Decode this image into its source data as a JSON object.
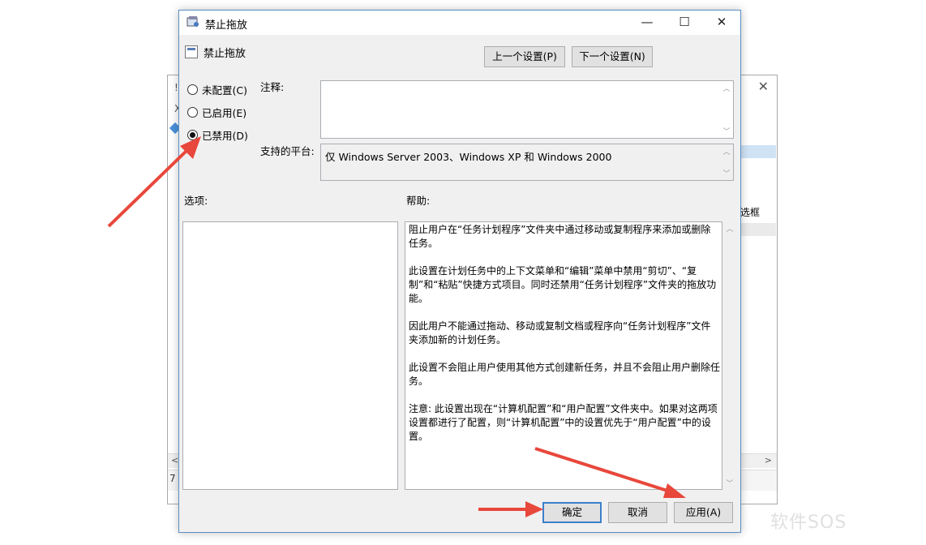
{
  "background_window": {
    "title_char": "!",
    "menu_char": "X",
    "side_text": "选框",
    "status_text": "7"
  },
  "dialog": {
    "title": "禁止拖放",
    "header": "禁止拖放",
    "prev_button": "上一个设置(P)",
    "next_button": "下一个设置(N)",
    "radios": [
      {
        "label": "未配置(C)",
        "selected": false
      },
      {
        "label": "已启用(E)",
        "selected": false
      },
      {
        "label": "已禁用(D)",
        "selected": true
      }
    ],
    "comment_label": "注释:",
    "comment_value": "",
    "platform_label": "支持的平台:",
    "platform_value": "仅 Windows Server 2003、Windows XP 和 Windows 2000",
    "options_label": "选项:",
    "help_label": "帮助:",
    "help_text": "阻止用户在“任务计划程序”文件夹中通过移动或复制程序来添加或删除任务。\n\n此设置在计划任务中的上下文菜单和“编辑”菜单中禁用“剪切”、“复制”和“粘贴”快捷方式项目。同时还禁用“任务计划程序”文件夹的拖放功能。\n\n因此用户不能通过拖动、移动或复制文档或程序向“任务计划程序”文件夹添加新的计划任务。\n\n此设置不会阻止用户使用其他方式创建新任务，并且不会阻止用户删除任务。\n\n注意: 此设置出现在“计算机配置”和“用户配置”文件夹中。如果对这两项设置都进行了配置，则“计算机配置”中的设置优先于“用户配置”中的设置。",
    "ok_button": "确定",
    "cancel_button": "取消",
    "apply_button": "应用(A)"
  },
  "watermark": "软件SOS",
  "colors": {
    "annotation_arrow": "#e8473b",
    "dialog_border": "#5a8fc4",
    "primary_button_border": "#3c7fcc"
  }
}
